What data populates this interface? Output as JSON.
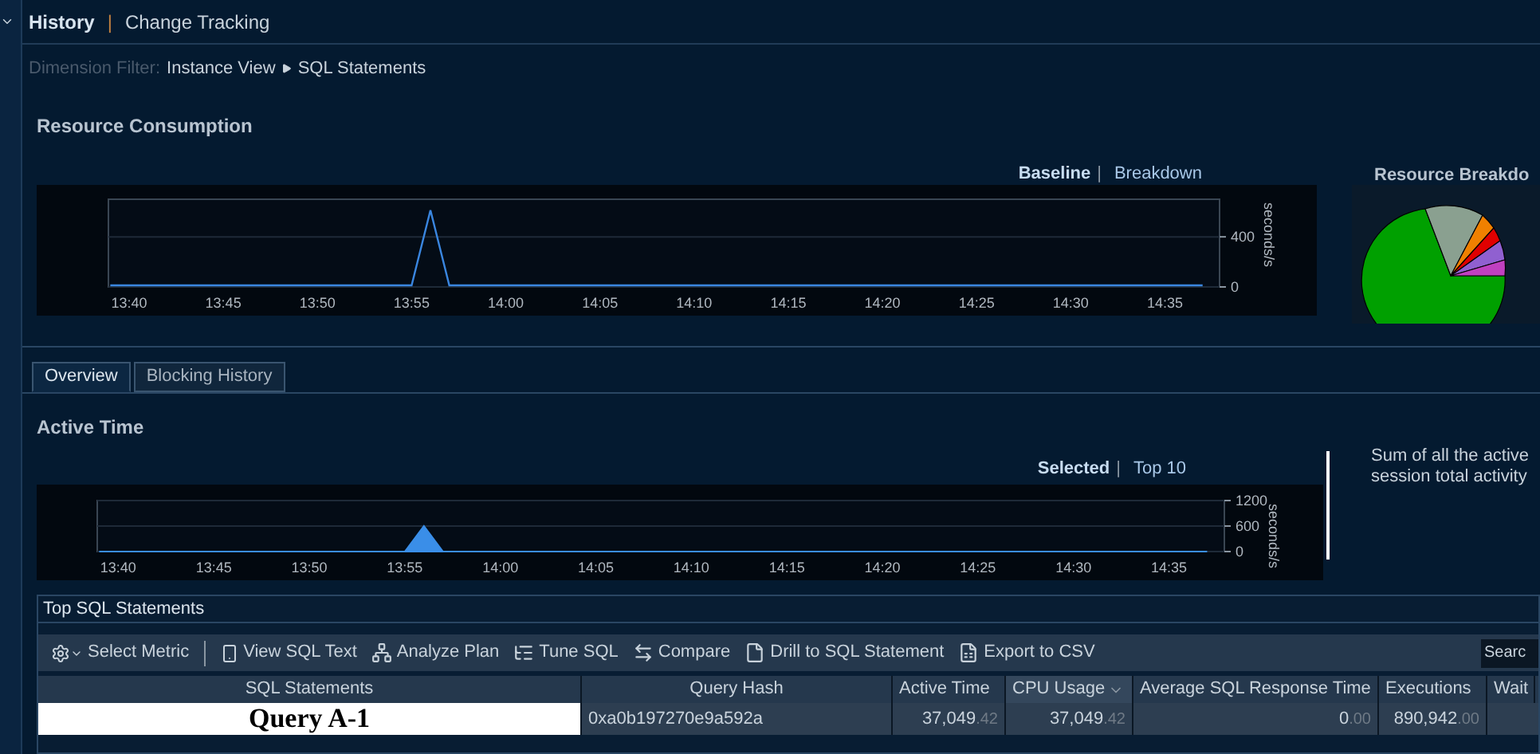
{
  "nav": {
    "separator": "|",
    "items": [
      {
        "label": "History",
        "selected": true
      },
      {
        "label": "Change Tracking",
        "selected": false
      }
    ]
  },
  "dimension_filter": {
    "label": "Dimension Filter:",
    "path": [
      "Instance View",
      "SQL Statements"
    ]
  },
  "resource_consumption": {
    "title": "Resource Consumption",
    "views_separator": "|",
    "views": [
      {
        "label": "Baseline",
        "selected": true
      },
      {
        "label": "Breakdown",
        "selected": false
      }
    ],
    "chart_data": {
      "type": "line",
      "ylabel": "seconds/s",
      "ylim": [
        0,
        700
      ],
      "yticks": [
        0,
        400
      ],
      "categories": [
        null,
        "13:40",
        null,
        null,
        null,
        null,
        "13:45",
        null,
        null,
        null,
        null,
        "13:50",
        null,
        null,
        null,
        null,
        "13:55",
        null,
        null,
        null,
        null,
        "14:00",
        null,
        null,
        null,
        null,
        "14:05",
        null,
        null,
        null,
        null,
        "14:10",
        null,
        null,
        null,
        null,
        "14:15",
        null,
        null,
        null,
        null,
        "14:20",
        null,
        null,
        null,
        null,
        "14:25",
        null,
        null,
        null,
        null,
        "14:30",
        null,
        null,
        null,
        null,
        "14:35",
        null,
        null
      ],
      "series": [
        {
          "color": "#3a86e0",
          "values": [
            0,
            0,
            0,
            0,
            0,
            0,
            0,
            0,
            0,
            0,
            0,
            0,
            0,
            0,
            0,
            0,
            0,
            600,
            0,
            0,
            0,
            0,
            0,
            0,
            0,
            0,
            0,
            0,
            0,
            0,
            0,
            0,
            0,
            0,
            0,
            0,
            0,
            0,
            0,
            0,
            0,
            0,
            0,
            0,
            0,
            0,
            0,
            0,
            0,
            0,
            0,
            0,
            0,
            0,
            0,
            0,
            0,
            0,
            0
          ]
        }
      ]
    },
    "breakdown_title": "Resource Breakdo"
  },
  "tabs": [
    {
      "label": "Overview",
      "selected": true
    },
    {
      "label": "Blocking History",
      "selected": false
    }
  ],
  "active_time": {
    "title": "Active Time",
    "views_separator": "|",
    "views": [
      {
        "label": "Selected",
        "selected": true
      },
      {
        "label": "Top 10",
        "selected": false
      }
    ],
    "chart_data": {
      "type": "area",
      "ylabel": "seconds/s",
      "ylim": [
        0,
        1200
      ],
      "yticks": [
        0,
        600,
        1200
      ],
      "categories": [
        null,
        "13:40",
        null,
        null,
        null,
        null,
        "13:45",
        null,
        null,
        null,
        null,
        "13:50",
        null,
        null,
        null,
        null,
        "13:55",
        null,
        null,
        null,
        null,
        "14:00",
        null,
        null,
        null,
        null,
        "14:05",
        null,
        null,
        null,
        null,
        "14:10",
        null,
        null,
        null,
        null,
        "14:15",
        null,
        null,
        null,
        null,
        "14:20",
        null,
        null,
        null,
        null,
        "14:25",
        null,
        null,
        null,
        null,
        "14:30",
        null,
        null,
        null,
        null,
        "14:35",
        null,
        null
      ],
      "series": [
        {
          "color": "#3a8ee8",
          "values": [
            0,
            0,
            0,
            0,
            0,
            0,
            0,
            0,
            0,
            0,
            0,
            0,
            0,
            0,
            0,
            0,
            0,
            600,
            0,
            0,
            0,
            0,
            0,
            0,
            0,
            0,
            0,
            0,
            0,
            0,
            0,
            0,
            0,
            0,
            0,
            0,
            0,
            0,
            0,
            0,
            0,
            0,
            0,
            0,
            0,
            0,
            0,
            0,
            0,
            0,
            0,
            0,
            0,
            0,
            0,
            0,
            0,
            0,
            0
          ]
        }
      ]
    },
    "description": [
      "Sum of all the active",
      "session total activity"
    ]
  },
  "top_sql": {
    "title": "Top SQL Statements",
    "toolbar": [
      {
        "kind": "gear",
        "label": "Select Metric"
      },
      {
        "kind": "sep"
      },
      {
        "kind": "view",
        "label": "View SQL Text"
      },
      {
        "kind": "plan",
        "label": "Analyze Plan"
      },
      {
        "kind": "tune",
        "label": "Tune SQL"
      },
      {
        "kind": "compare",
        "label": "Compare"
      },
      {
        "kind": "drill",
        "label": "Drill to SQL Statement"
      },
      {
        "kind": "csv",
        "label": "Export to CSV"
      }
    ],
    "search": {
      "placeholder": "Searc"
    },
    "columns": [
      {
        "label": "SQL Statements",
        "sorted": false
      },
      {
        "label": "Query Hash",
        "sorted": false
      },
      {
        "label": "Active Time",
        "sorted": false
      },
      {
        "label": "CPU Usage",
        "sorted": true
      },
      {
        "label": "Average SQL Response Time",
        "sorted": false
      },
      {
        "label": "Executions",
        "sorted": false
      },
      {
        "label": "Wait",
        "sorted": false
      }
    ],
    "rows": [
      {
        "statement": "Query A-1",
        "hash": "0xa0b197270e9a592a",
        "active_time": [
          "37,049",
          ".42"
        ],
        "cpu_usage": [
          "37,049",
          ".42"
        ],
        "avg_response": [
          "0",
          ".00"
        ],
        "executions": [
          "890,942",
          ".00"
        ]
      }
    ]
  }
}
